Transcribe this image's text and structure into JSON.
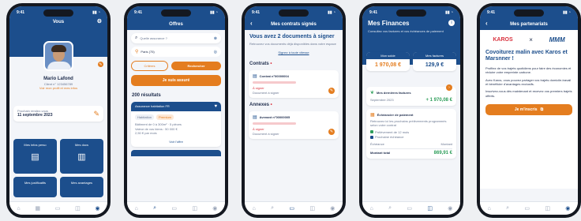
{
  "phone1": {
    "time": "9:41",
    "title": "Vous",
    "name": "Mario Lafond",
    "client_line": "Client n° 123456789",
    "profile_link": "Voir mon profil et mes infos",
    "next_title": "Prochain rendez-vous",
    "next_date": "11 septembre 2023",
    "tiles": [
      {
        "label": "Mes infos perso"
      },
      {
        "label": "Mes docs"
      },
      {
        "label": "Mes justificatifs"
      },
      {
        "label": "Mes avantages"
      }
    ]
  },
  "phone2": {
    "time": "9:41",
    "title": "Offres",
    "search_placeholder": "Quelle assurance ?",
    "location_value": "Paris (75)",
    "chip_left": "Critères",
    "chip_right": "Rechercher",
    "cta": "Je suis assuré",
    "results": "200 résultats",
    "offer_title": "Assurance habitation FR",
    "offer_badges": [
      "Habitation",
      "Premium"
    ],
    "offer_lines": [
      "Bâtiment de 0 à 300m² · 5 pièces",
      "Valeur de vos biens : 50 000 €",
      "2,50 € par mois"
    ],
    "see_offer": "Voir l'offre"
  },
  "phone3": {
    "time": "9:41",
    "title": "Mes contrats signés",
    "heading": "Vous avez 2 documents à signer",
    "subtext": "Retrouvez vos documents déjà disponibles dans votre espace",
    "link": "Signez à toute vitesse",
    "section1": "Contrats",
    "contract_title": "Contrat n°00000004",
    "section2": "Annexes",
    "annex_title": "Avenant n°00000005",
    "status_label": "À signer",
    "doc_label": "Document à signer"
  },
  "phone4": {
    "time": "9:41",
    "title": "Mes Finances",
    "subtitle": "Consultez vos factures et vos échéances de paiement",
    "box1_label": "Mon solde",
    "box1_value": "1 970,08 €",
    "box2_label": "Mes factures",
    "box2_value": "129,9 €",
    "invoice_label": "Mes dernières factures",
    "invoice_date": "Septembre 2023",
    "invoice_amount": "+ 1 970,08 €",
    "payment_title": "Échéancier de paiement",
    "payment_text": "Retrouvez ici les prochains prélèvements programmés selon votre contrat",
    "sub_items": [
      "Prélèvement de 12 mois",
      "Prochaine échéance"
    ],
    "small_labels": [
      "Échéance",
      "Montant"
    ],
    "total_label": "Montant total",
    "total_value": "869,91 €"
  },
  "phone5": {
    "time": "9:41",
    "title": "Mes partenariats",
    "brand_left": "KAROS",
    "brand_right": "MMM",
    "heading": "Covoiturez malin avec Karos et Marsnner !",
    "paragraphs": [
      "Profitez de vos trajets quotidiens pour faire des économies et réduire votre empreinte carbone.",
      "Avec Karos, vous pouvez partager vos trajets domicile-travail et bénéficier d'avantages exclusifs.",
      "Inscrivez-vous dès maintenant et recevez vos premiers trajets offerts."
    ],
    "cta": "Je m'inscris"
  },
  "colors": {
    "navy": "#1c4e8c",
    "orange": "#e47d1f",
    "green": "#2e9e5a"
  }
}
